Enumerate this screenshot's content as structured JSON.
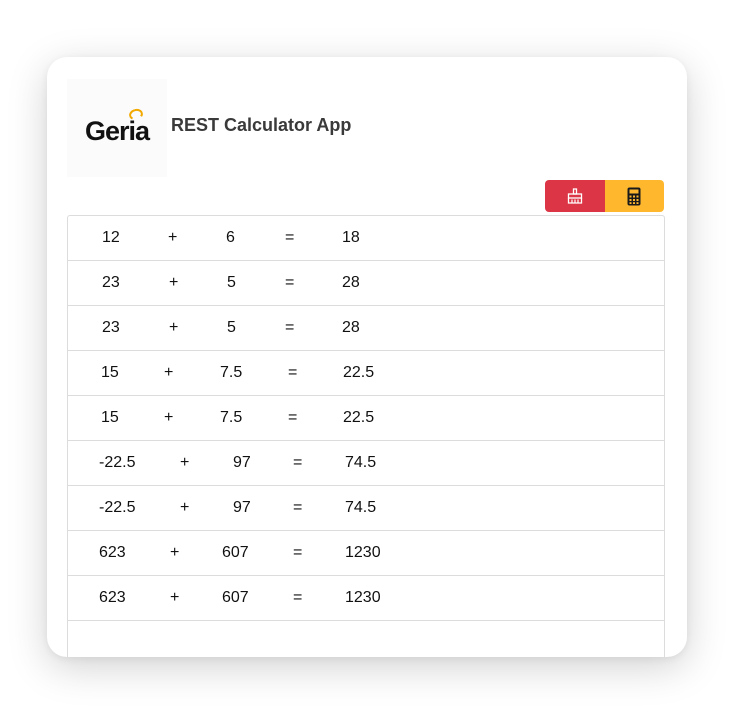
{
  "app": {
    "logo_text": "Geria",
    "title": "REST Calculator App"
  },
  "toolbar": {
    "clear_icon": "broom-icon",
    "calc_icon": "calculator-icon",
    "colors": {
      "clear": "#dc3545",
      "calc": "#ffb82e"
    }
  },
  "history": [
    {
      "a": "12",
      "op": "+",
      "b": "6",
      "eq": "=",
      "result": "18"
    },
    {
      "a": "23",
      "op": "+",
      "b": "5",
      "eq": "=",
      "result": "28"
    },
    {
      "a": "23",
      "op": "+",
      "b": "5",
      "eq": "=",
      "result": "28"
    },
    {
      "a": "15",
      "op": "+",
      "b": "7.5",
      "eq": "=",
      "result": "22.5"
    },
    {
      "a": "15",
      "op": "+",
      "b": "7.5",
      "eq": "=",
      "result": "22.5"
    },
    {
      "a": "-22.5",
      "op": "+",
      "b": "97",
      "eq": "=",
      "result": "74.5"
    },
    {
      "a": "-22.5",
      "op": "+",
      "b": "97",
      "eq": "=",
      "result": "74.5"
    },
    {
      "a": "623",
      "op": "+",
      "b": "607",
      "eq": "=",
      "result": "1230"
    },
    {
      "a": "623",
      "op": "+",
      "b": "607",
      "eq": "=",
      "result": "1230"
    }
  ]
}
